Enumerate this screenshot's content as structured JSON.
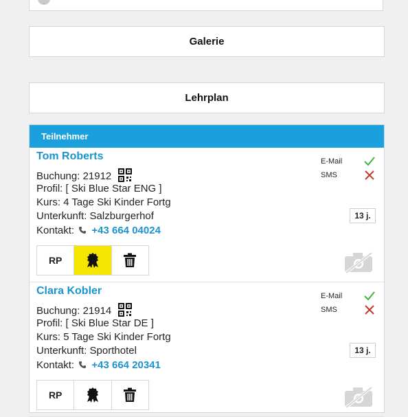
{
  "nav": {
    "galerie_label": "Galerie",
    "lehrplan_label": "Lehrplan"
  },
  "panel": {
    "title": "Teilnehmer"
  },
  "participants": [
    {
      "name": "Tom Roberts",
      "booking_label": "Buchung:",
      "booking_number": "21912",
      "profile_label": "Profil:",
      "profile": "[ Ski Blue Star ENG ]",
      "course_label": "Kurs:",
      "course": "4 Tage Ski Kinder Fortg",
      "lodging_label": "Unterkunft:",
      "lodging": "Salzburgerhof",
      "contact_label": "Kontakt:",
      "phone": "+43 664 04024",
      "email_label": "E-Mail",
      "sms_label": "SMS",
      "age": "13 j.",
      "rp_label": "RP"
    },
    {
      "name": "Clara Kobler",
      "booking_label": "Buchung:",
      "booking_number": "21914",
      "profile_label": "Profil:",
      "profile": "[ Ski Blue Star DE ]",
      "course_label": "Kurs:",
      "course": "5 Tage Ski Kinder Fortg",
      "lodging_label": "Unterkunft:",
      "lodging": "Sporthotel",
      "contact_label": "Kontakt:",
      "phone": "+43 664 20341",
      "email_label": "E-Mail",
      "sms_label": "SMS",
      "age": "13 j.",
      "rp_label": "RP"
    }
  ],
  "colors": {
    "accent": "#1aa0dc",
    "check": "#3cb43c",
    "cross": "#c0392b",
    "highlight": "#f4e600"
  }
}
